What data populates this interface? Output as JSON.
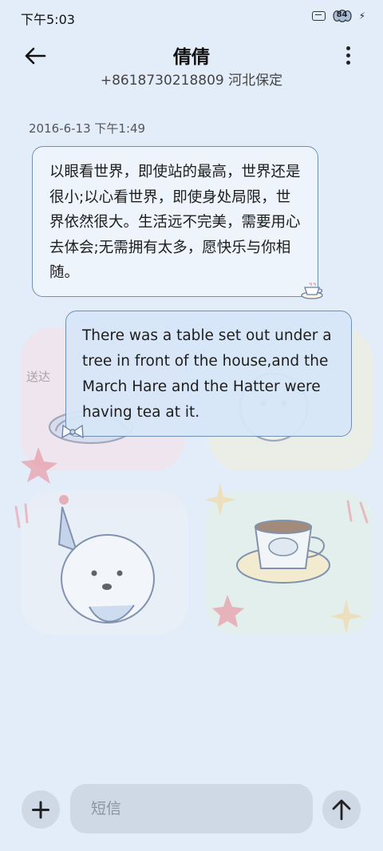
{
  "status_bar": {
    "time": "下午5:03",
    "battery_level": "84",
    "icons": [
      "sim-icon",
      "battery-icon",
      "charging-bolt-icon"
    ]
  },
  "header": {
    "contact_name": "倩倩",
    "contact_number": "+8618730218809 河北保定",
    "back_icon": "arrow-left-icon",
    "more_icon": "more-vertical-icon"
  },
  "conversation": {
    "timestamp": "2016-6-13 下午1:49",
    "messages": [
      {
        "direction": "incoming",
        "text": "以眼看世界，即使站的最高，世界还是很小;以心看世界，即使身处局限，世界依然很大。生活远不完美，需要用心去体会;无需拥有太多，愿快乐与你相随。"
      },
      {
        "direction": "outgoing",
        "text": "There was a table set out under a tree in front of the house,and the March Hare and the Hatter were having tea at it.",
        "status": "送达"
      }
    ]
  },
  "composer": {
    "placeholder": "短信",
    "add_icon": "plus-icon",
    "send_icon": "arrow-up-icon"
  },
  "colors": {
    "background": "#e3edf9",
    "bubble_border": "#6e90b4",
    "composer_button": "#cfd9e6"
  }
}
